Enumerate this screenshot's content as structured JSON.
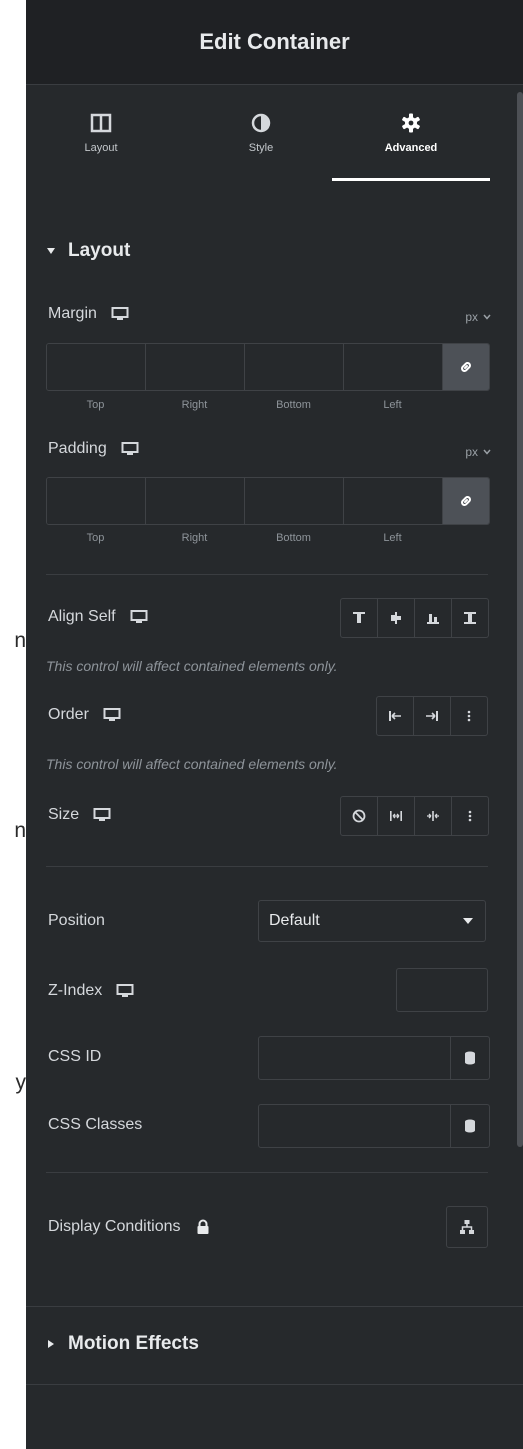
{
  "edge_fragments": [
    "n",
    "n",
    "y"
  ],
  "header": {
    "title": "Edit Container"
  },
  "tabs": [
    {
      "label": "Layout",
      "icon": "columns-icon",
      "active": false
    },
    {
      "label": "Style",
      "icon": "contrast-half-circle-icon",
      "active": false
    },
    {
      "label": "Advanced",
      "icon": "gear-icon",
      "active": true
    }
  ],
  "layout_section": {
    "title": "Layout",
    "margin": {
      "label": "Margin",
      "unit": "px",
      "top": "",
      "right": "",
      "bottom": "",
      "left": "",
      "linked": true
    },
    "padding": {
      "label": "Padding",
      "unit": "px",
      "top": "",
      "right": "",
      "bottom": "",
      "left": "",
      "linked": true
    },
    "dim_labels": {
      "top": "Top",
      "right": "Right",
      "bottom": "Bottom",
      "left": "Left"
    },
    "align_self": {
      "label": "Align Self",
      "options": [
        "align-start-icon",
        "align-center-icon",
        "align-end-icon",
        "align-stretch-icon"
      ]
    },
    "align_note": "This control will affect contained elements only.",
    "order": {
      "label": "Order",
      "options": [
        "order-start-icon",
        "order-end-icon",
        "more-dots-icon"
      ]
    },
    "order_note": "This control will affect contained elements only.",
    "size": {
      "label": "Size",
      "options": [
        "none-circle-icon",
        "grow-icon",
        "shrink-icon",
        "more-dots-icon"
      ]
    },
    "position": {
      "label": "Position",
      "value": "Default"
    },
    "z_index": {
      "label": "Z-Index",
      "value": ""
    },
    "css_id": {
      "label": "CSS ID",
      "value": ""
    },
    "css_classes": {
      "label": "CSS Classes",
      "value": ""
    },
    "display_conditions": {
      "label": "Display Conditions"
    }
  },
  "motion_effects": {
    "title": "Motion Effects"
  },
  "colors": {
    "panel_bg": "#26292c",
    "header_bg": "#1f2124",
    "border": "#3f4246",
    "text": "#d5d8dc",
    "muted": "#8e949a"
  }
}
